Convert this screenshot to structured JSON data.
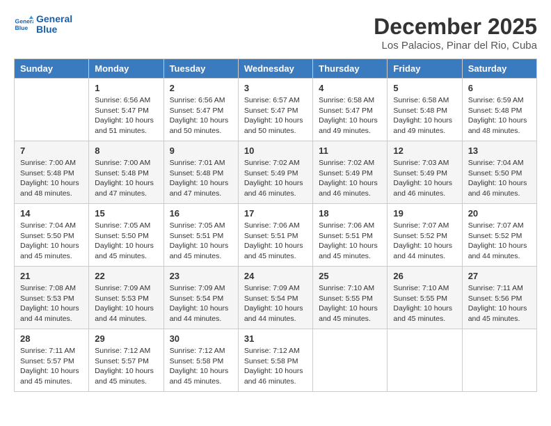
{
  "header": {
    "logo_line1": "General",
    "logo_line2": "Blue",
    "title": "December 2025",
    "subtitle": "Los Palacios, Pinar del Rio, Cuba"
  },
  "calendar": {
    "headers": [
      "Sunday",
      "Monday",
      "Tuesday",
      "Wednesday",
      "Thursday",
      "Friday",
      "Saturday"
    ],
    "weeks": [
      [
        {
          "day": "",
          "info": ""
        },
        {
          "day": "1",
          "info": "Sunrise: 6:56 AM\nSunset: 5:47 PM\nDaylight: 10 hours\nand 51 minutes."
        },
        {
          "day": "2",
          "info": "Sunrise: 6:56 AM\nSunset: 5:47 PM\nDaylight: 10 hours\nand 50 minutes."
        },
        {
          "day": "3",
          "info": "Sunrise: 6:57 AM\nSunset: 5:47 PM\nDaylight: 10 hours\nand 50 minutes."
        },
        {
          "day": "4",
          "info": "Sunrise: 6:58 AM\nSunset: 5:47 PM\nDaylight: 10 hours\nand 49 minutes."
        },
        {
          "day": "5",
          "info": "Sunrise: 6:58 AM\nSunset: 5:48 PM\nDaylight: 10 hours\nand 49 minutes."
        },
        {
          "day": "6",
          "info": "Sunrise: 6:59 AM\nSunset: 5:48 PM\nDaylight: 10 hours\nand 48 minutes."
        }
      ],
      [
        {
          "day": "7",
          "info": "Sunrise: 7:00 AM\nSunset: 5:48 PM\nDaylight: 10 hours\nand 48 minutes."
        },
        {
          "day": "8",
          "info": "Sunrise: 7:00 AM\nSunset: 5:48 PM\nDaylight: 10 hours\nand 47 minutes."
        },
        {
          "day": "9",
          "info": "Sunrise: 7:01 AM\nSunset: 5:48 PM\nDaylight: 10 hours\nand 47 minutes."
        },
        {
          "day": "10",
          "info": "Sunrise: 7:02 AM\nSunset: 5:49 PM\nDaylight: 10 hours\nand 46 minutes."
        },
        {
          "day": "11",
          "info": "Sunrise: 7:02 AM\nSunset: 5:49 PM\nDaylight: 10 hours\nand 46 minutes."
        },
        {
          "day": "12",
          "info": "Sunrise: 7:03 AM\nSunset: 5:49 PM\nDaylight: 10 hours\nand 46 minutes."
        },
        {
          "day": "13",
          "info": "Sunrise: 7:04 AM\nSunset: 5:50 PM\nDaylight: 10 hours\nand 46 minutes."
        }
      ],
      [
        {
          "day": "14",
          "info": "Sunrise: 7:04 AM\nSunset: 5:50 PM\nDaylight: 10 hours\nand 45 minutes."
        },
        {
          "day": "15",
          "info": "Sunrise: 7:05 AM\nSunset: 5:50 PM\nDaylight: 10 hours\nand 45 minutes."
        },
        {
          "day": "16",
          "info": "Sunrise: 7:05 AM\nSunset: 5:51 PM\nDaylight: 10 hours\nand 45 minutes."
        },
        {
          "day": "17",
          "info": "Sunrise: 7:06 AM\nSunset: 5:51 PM\nDaylight: 10 hours\nand 45 minutes."
        },
        {
          "day": "18",
          "info": "Sunrise: 7:06 AM\nSunset: 5:51 PM\nDaylight: 10 hours\nand 45 minutes."
        },
        {
          "day": "19",
          "info": "Sunrise: 7:07 AM\nSunset: 5:52 PM\nDaylight: 10 hours\nand 44 minutes."
        },
        {
          "day": "20",
          "info": "Sunrise: 7:07 AM\nSunset: 5:52 PM\nDaylight: 10 hours\nand 44 minutes."
        }
      ],
      [
        {
          "day": "21",
          "info": "Sunrise: 7:08 AM\nSunset: 5:53 PM\nDaylight: 10 hours\nand 44 minutes."
        },
        {
          "day": "22",
          "info": "Sunrise: 7:09 AM\nSunset: 5:53 PM\nDaylight: 10 hours\nand 44 minutes."
        },
        {
          "day": "23",
          "info": "Sunrise: 7:09 AM\nSunset: 5:54 PM\nDaylight: 10 hours\nand 44 minutes."
        },
        {
          "day": "24",
          "info": "Sunrise: 7:09 AM\nSunset: 5:54 PM\nDaylight: 10 hours\nand 44 minutes."
        },
        {
          "day": "25",
          "info": "Sunrise: 7:10 AM\nSunset: 5:55 PM\nDaylight: 10 hours\nand 45 minutes."
        },
        {
          "day": "26",
          "info": "Sunrise: 7:10 AM\nSunset: 5:55 PM\nDaylight: 10 hours\nand 45 minutes."
        },
        {
          "day": "27",
          "info": "Sunrise: 7:11 AM\nSunset: 5:56 PM\nDaylight: 10 hours\nand 45 minutes."
        }
      ],
      [
        {
          "day": "28",
          "info": "Sunrise: 7:11 AM\nSunset: 5:57 PM\nDaylight: 10 hours\nand 45 minutes."
        },
        {
          "day": "29",
          "info": "Sunrise: 7:12 AM\nSunset: 5:57 PM\nDaylight: 10 hours\nand 45 minutes."
        },
        {
          "day": "30",
          "info": "Sunrise: 7:12 AM\nSunset: 5:58 PM\nDaylight: 10 hours\nand 45 minutes."
        },
        {
          "day": "31",
          "info": "Sunrise: 7:12 AM\nSunset: 5:58 PM\nDaylight: 10 hours\nand 46 minutes."
        },
        {
          "day": "",
          "info": ""
        },
        {
          "day": "",
          "info": ""
        },
        {
          "day": "",
          "info": ""
        }
      ]
    ]
  }
}
